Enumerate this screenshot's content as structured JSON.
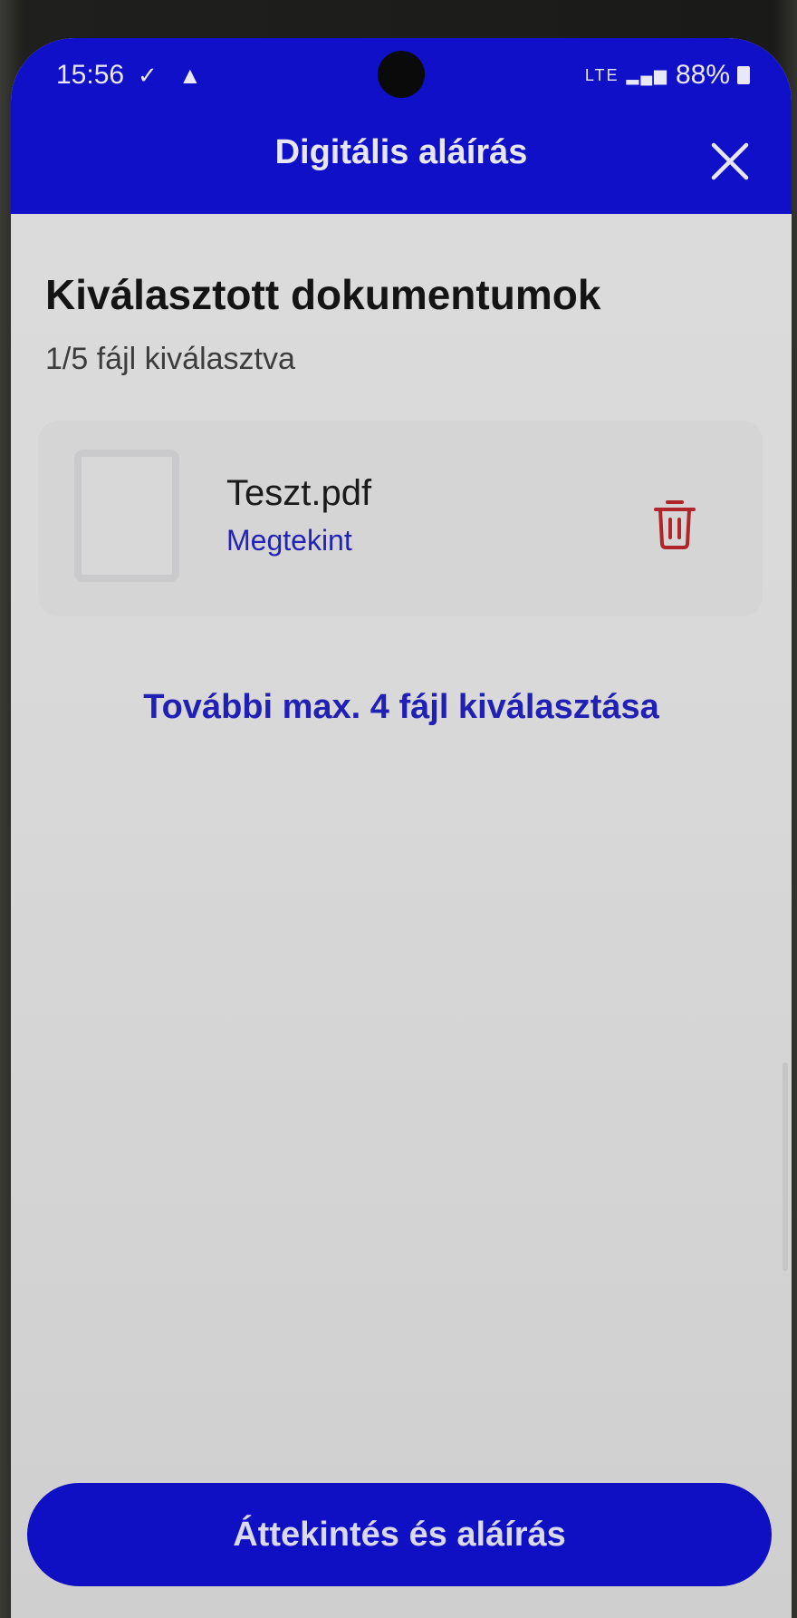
{
  "status_bar": {
    "time": "15:56",
    "left_icons": "✓ ▲",
    "network": "LTE",
    "battery": "88%"
  },
  "header": {
    "title": "Digitális aláírás",
    "close_icon": "close-icon"
  },
  "section": {
    "title": "Kiválasztott dokumentumok",
    "subtitle": "1/5 fájl kiválasztva"
  },
  "files": [
    {
      "name": "Teszt.pdf",
      "view_label": "Megtekint"
    }
  ],
  "actions": {
    "more_files": "További max. 4 fájl kiválasztása",
    "primary_button": "Áttekintés és aláírás"
  },
  "colors": {
    "brand": "#1010c8",
    "link": "#2323b8",
    "danger": "#b0242a"
  }
}
